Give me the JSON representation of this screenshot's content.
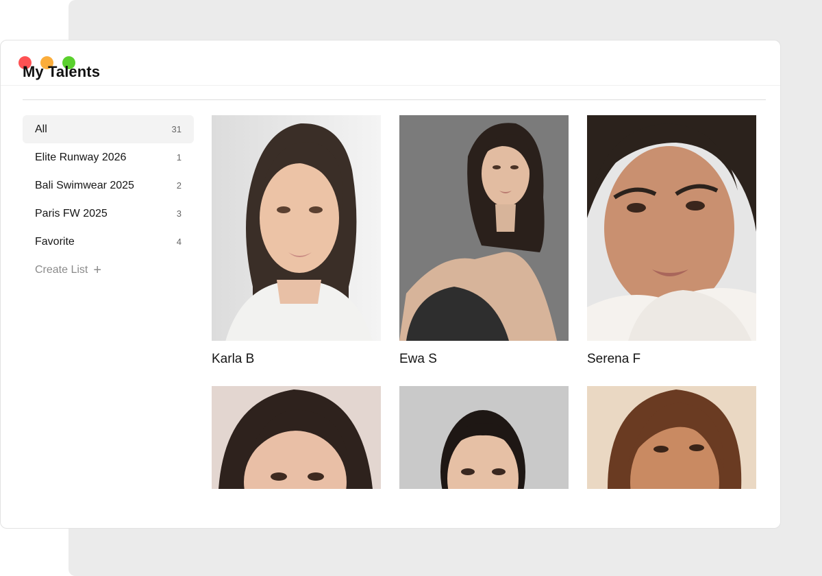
{
  "page": {
    "title": "My Talents"
  },
  "lists": [
    {
      "label": "All",
      "count": "31",
      "active": true
    },
    {
      "label": "Elite Runway 2026",
      "count": "1"
    },
    {
      "label": "Bali Swimwear 2025",
      "count": "2"
    },
    {
      "label": "Paris FW 2025",
      "count": "3"
    },
    {
      "label": "Favorite",
      "count": "4"
    }
  ],
  "create_list": {
    "label": "Create List",
    "icon": "plus-icon"
  },
  "talents": [
    {
      "name": "Karla B"
    },
    {
      "name": "Ewa S"
    },
    {
      "name": "Serena F"
    },
    {
      "name": ""
    },
    {
      "name": ""
    },
    {
      "name": ""
    }
  ],
  "colors": {
    "close": "#fe5153",
    "minimize": "#fbad3b",
    "maximize": "#5ad02d",
    "active_item_bg": "#f3f3f3"
  }
}
